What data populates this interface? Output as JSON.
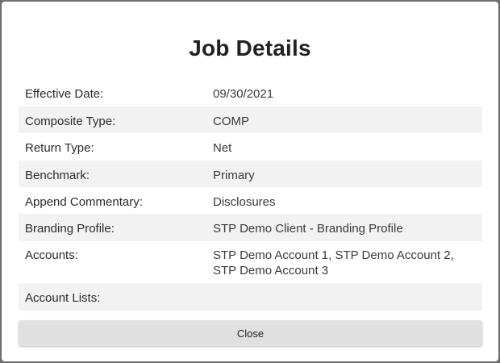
{
  "dialog": {
    "title": "Job Details",
    "close_label": "Close"
  },
  "details": [
    {
      "label": "Effective Date:",
      "value": "09/30/2021"
    },
    {
      "label": "Composite Type:",
      "value": "COMP"
    },
    {
      "label": "Return Type:",
      "value": "Net"
    },
    {
      "label": "Benchmark:",
      "value": "Primary"
    },
    {
      "label": "Append Commentary:",
      "value": "Disclosures"
    },
    {
      "label": "Branding Profile:",
      "value": "STP Demo Client - Branding Profile"
    },
    {
      "label": "Accounts:",
      "value": "STP Demo Account 1, STP Demo Account 2, STP Demo Account 3"
    },
    {
      "label": "Account Lists:",
      "value": ""
    }
  ],
  "colors": {
    "row_alt": "#f2f2f2",
    "button_bg": "#e0e0e0"
  }
}
